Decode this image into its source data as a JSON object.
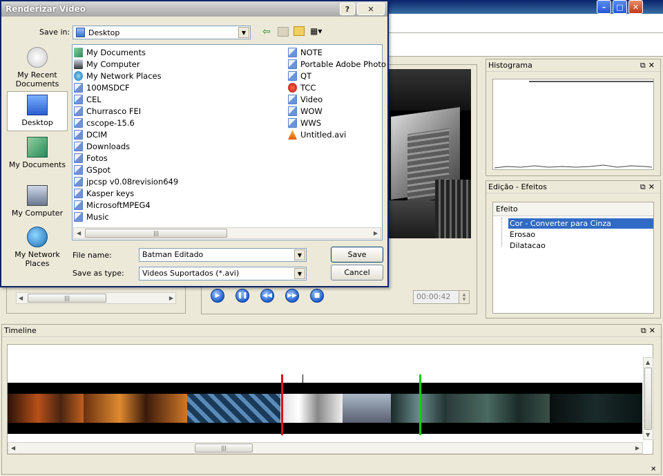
{
  "dialog": {
    "title": "Renderizar Video",
    "help_glyph": "?",
    "close_glyph": "✕",
    "save_in_label": "Save in:",
    "save_in_value": "Desktop",
    "file_name_label": "File name:",
    "file_name_value": "Batman Editado",
    "save_as_type_label": "Save as type:",
    "save_as_type_value": "Videos Suportados (*.avi)",
    "save_button": "Save",
    "cancel_button": "Cancel",
    "places": [
      {
        "label": "My Recent Documents",
        "icon": "recent-documents-icon"
      },
      {
        "label": "Desktop",
        "icon": "desktop-icon"
      },
      {
        "label": "My Documents",
        "icon": "my-documents-icon"
      },
      {
        "label": "My Computer",
        "icon": "my-computer-icon"
      },
      {
        "label": "My Network Places",
        "icon": "network-places-icon"
      }
    ],
    "files_col1": [
      "My Documents",
      "My Computer",
      "My Network Places",
      "100MSDCF",
      "CEL",
      "Churrasco FEI",
      "cscope-15.6",
      "DCIM",
      "Downloads",
      "Fotos",
      "GSpot",
      "jpcsp v0.08revision649",
      "Kasper keys",
      "MicrosoftMPEG4",
      "Music"
    ],
    "files_col2": [
      "NOTE",
      "Portable Adobe Photo",
      "QT",
      "TCC",
      "Video",
      "WOW",
      "WWS",
      "Untitled.avi"
    ]
  },
  "player": {
    "timecode": "00:00:42",
    "buttons": [
      "play",
      "pause",
      "rewind",
      "fast-forward",
      "stop"
    ]
  },
  "histogram": {
    "title": "Histograma"
  },
  "effects": {
    "title": "Edição - Efeitos",
    "header": "Efeito",
    "items": [
      "Cor - Converter para Cinza",
      "Erosao",
      "Dilatacao"
    ],
    "selected_index": 0
  },
  "timeline": {
    "title": "Timeline"
  },
  "colors": {
    "selection": "#316ac5",
    "marker_in": "#e01010",
    "marker_out": "#10d010"
  }
}
